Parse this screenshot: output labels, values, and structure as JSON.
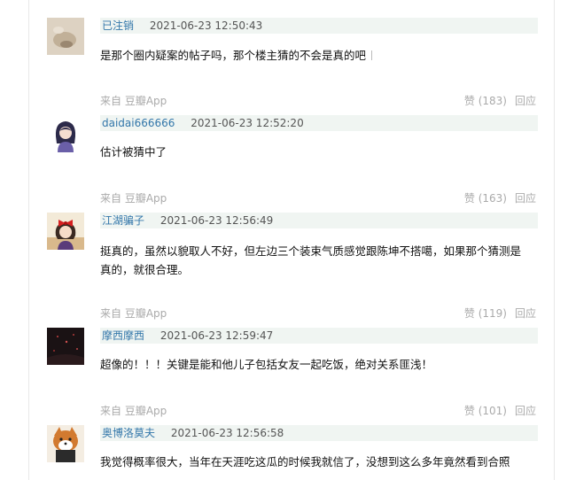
{
  "comments": [
    {
      "author": "已注销",
      "time": "2021-06-23 12:50:43",
      "text": "是那个圈内疑案的帖子吗，那个楼主猜的不会是真的吧",
      "source": "来自 豆瓣App",
      "like_label": "赞 (183)",
      "reply_label": "回应",
      "avatar_icon": "blurred-photo-avatar"
    },
    {
      "author": "daidai666666",
      "time": "2021-06-23 12:52:20",
      "text": "估计被猜中了",
      "source": "来自 豆瓣App",
      "like_label": "赞 (163)",
      "reply_label": "回应",
      "avatar_icon": "cartoon-girl-avatar"
    },
    {
      "author": "江湖骗子",
      "time": "2021-06-23 12:56:49",
      "text": "挺真的，虽然以貌取人不好，但左边三个装束气质感觉跟陈坤不搭噶，如果那个猜测是真的，就很合理。",
      "source": "来自 豆瓣App",
      "like_label": "赞 (119)",
      "reply_label": "回应",
      "avatar_icon": "anime-girl-red-bow-avatar"
    },
    {
      "author": "摩西摩西",
      "time": "2021-06-23 12:59:47",
      "text": "超像的！！！关键是能和他儿子包括女友一起吃饭，绝对关系匪浅！",
      "source": "来自 豆瓣App",
      "like_label": "赞 (101)",
      "reply_label": "回应",
      "avatar_icon": "dark-night-avatar"
    },
    {
      "author": "奥博洛莫夫",
      "time": "2021-06-23 12:56:58",
      "text": "我觉得概率很大，当年在天涯吃这瓜的时候我就信了，没想到这么多年竟然看到合照",
      "source": "",
      "like_label": "",
      "reply_label": "",
      "avatar_icon": "shiba-dog-avatar"
    }
  ]
}
